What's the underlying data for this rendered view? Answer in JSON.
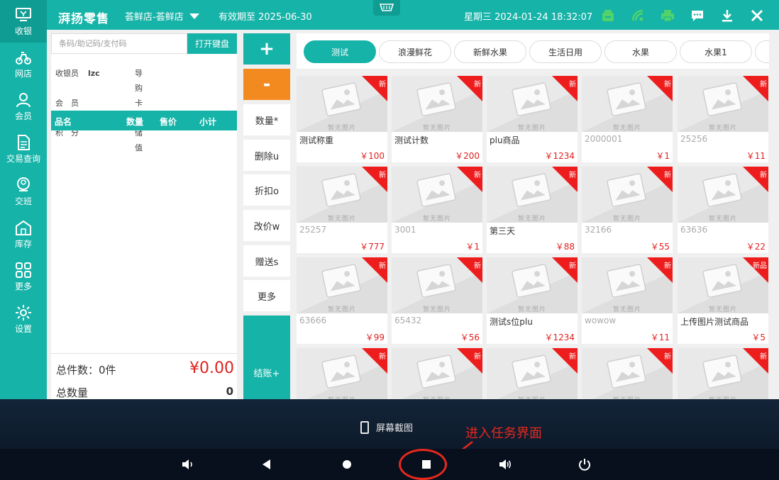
{
  "header": {
    "logo": "湃扬零售",
    "store": "荟鲜店-荟鲜店",
    "valid_until": "有效期至 2025-06-30",
    "datetime": "星期三 2024-01-24 18:32:07"
  },
  "sidebar": {
    "items": [
      {
        "label": "收银",
        "icon": "monitor-icon"
      },
      {
        "label": "网店",
        "icon": "bike-icon"
      },
      {
        "label": "会员",
        "icon": "user-icon"
      },
      {
        "label": "交易查询",
        "icon": "document-icon"
      },
      {
        "label": "交班",
        "icon": "handover-icon"
      },
      {
        "label": "库存",
        "icon": "warehouse-icon"
      },
      {
        "label": "更多",
        "icon": "grid-icon"
      },
      {
        "label": "设置",
        "icon": "gear-icon"
      }
    ]
  },
  "order": {
    "search_placeholder": "条码/助记码/支付码",
    "keyboard_button": "打开键盘",
    "info": {
      "cashier_label": "收银员",
      "cashier_value": "lzc",
      "guide_label": "导　购",
      "member_label": "会　员",
      "card_label": "卡　号",
      "points_label": "积　分",
      "balance_label": "储　值"
    },
    "columns": [
      "品名",
      "数量",
      "售价",
      "小计"
    ],
    "total_items_label": "总件数：0件",
    "total_amount": "¥0.00",
    "total_qty_label": "总数量",
    "total_qty_value": "0"
  },
  "actions": {
    "plus": "+",
    "minus": "-",
    "quantity": "数量*",
    "delete": "删除u",
    "discount": "折扣o",
    "change_price": "改价w",
    "gift": "赠送s",
    "more": "更多",
    "checkout": "结账+"
  },
  "categories": [
    "测试",
    "浪漫鲜花",
    "新鲜水果",
    "生活日用",
    "水果",
    "水果1"
  ],
  "placeholder_text": "暂无图片",
  "products": [
    {
      "name": "测试称重",
      "price": "￥100",
      "badge": "新",
      "gray": false
    },
    {
      "name": "测试计数",
      "price": "￥200",
      "badge": "新",
      "gray": false
    },
    {
      "name": "plu商品",
      "price": "￥1234",
      "badge": "新",
      "gray": false
    },
    {
      "name": "2000001",
      "price": "￥1",
      "badge": "新",
      "gray": true
    },
    {
      "name": "25256",
      "price": "￥11",
      "badge": "新",
      "gray": true
    },
    {
      "name": "25257",
      "price": "￥777",
      "badge": "新",
      "gray": true
    },
    {
      "name": "3001",
      "price": "￥1",
      "badge": "新",
      "gray": true
    },
    {
      "name": "第三天",
      "price": "￥88",
      "badge": "新",
      "gray": false
    },
    {
      "name": "32166",
      "price": "￥55",
      "badge": "新",
      "gray": true
    },
    {
      "name": "63636",
      "price": "￥22",
      "badge": "新",
      "gray": true
    },
    {
      "name": "63666",
      "price": "￥99",
      "badge": "新",
      "gray": true
    },
    {
      "name": "65432",
      "price": "￥56",
      "badge": "新",
      "gray": true
    },
    {
      "name": "测试s位plu",
      "price": "￥1234",
      "badge": "新",
      "gray": false
    },
    {
      "name": "wowow",
      "price": "￥11",
      "badge": "新",
      "gray": true
    },
    {
      "name": "上传图片测试商品",
      "price": "￥5",
      "badge": "新品",
      "gray": false
    },
    {
      "name": "",
      "price": "",
      "badge": "新",
      "gray": false
    },
    {
      "name": "",
      "price": "",
      "badge": "新",
      "gray": false
    },
    {
      "name": "",
      "price": "",
      "badge": "新",
      "gray": false
    },
    {
      "name": "",
      "price": "",
      "badge": "新",
      "gray": false
    },
    {
      "name": "",
      "price": "",
      "badge": "新",
      "gray": false
    }
  ],
  "system": {
    "screenshot_label": "屏幕截图",
    "annotation": "进入任务界面"
  },
  "colors": {
    "accent": "#16b3a8",
    "orange": "#f28a1f",
    "price_red": "#e02020",
    "badge_red": "#ee1d1d"
  }
}
